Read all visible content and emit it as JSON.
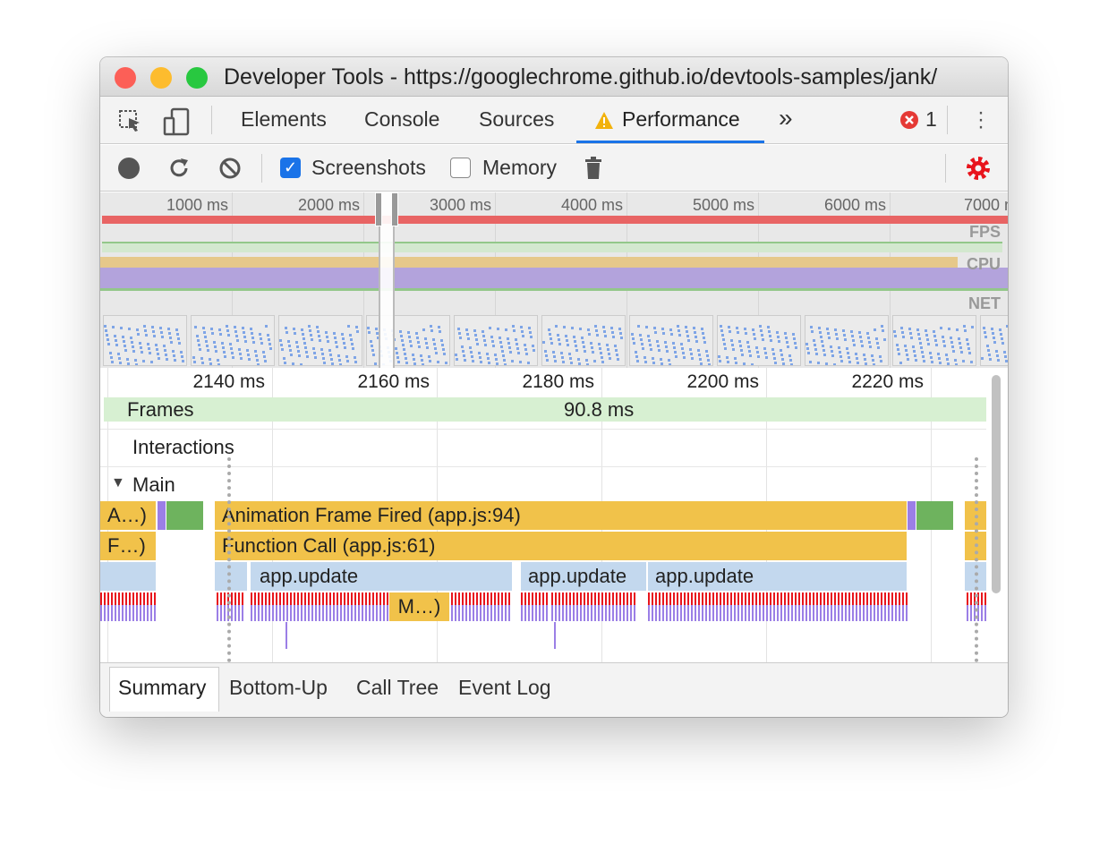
{
  "window": {
    "title": "Developer Tools - https://googlechrome.github.io/devtools-samples/jank/"
  },
  "tabs": {
    "items": [
      "Elements",
      "Console",
      "Sources",
      "Performance"
    ],
    "active": "Performance",
    "more": "»",
    "error_count": "1"
  },
  "toolbar": {
    "screenshots_label": "Screenshots",
    "screenshots_checked": true,
    "memory_label": "Memory",
    "memory_checked": false
  },
  "overview": {
    "ticks": [
      "1000 ms",
      "2000 ms",
      "3000 ms",
      "4000 ms",
      "5000 ms",
      "6000 ms",
      "7000 m"
    ],
    "labels": {
      "fps": "FPS",
      "cpu": "CPU",
      "net": "NET"
    }
  },
  "timeline": {
    "ticks": [
      "2140 ms",
      "2160 ms",
      "2180 ms",
      "2200 ms",
      "2220 ms"
    ],
    "frames_label": "Frames",
    "frame_duration": "90.8 ms",
    "interactions_label": "Interactions",
    "main_label": "Main"
  },
  "flame": {
    "animation_short": "A…)",
    "animation": "Animation Frame Fired (app.js:94)",
    "function_short": "F…)",
    "function": "Function Call (app.js:61)",
    "update": "app.update",
    "misc": "M…)"
  },
  "colors": {
    "scripting": "#f1c24a",
    "rendering": "#9b7fe6",
    "painting": "#6eb35e",
    "update": "#c3d8ee",
    "long_task": "#e86464"
  },
  "bottom_tabs": [
    "Summary",
    "Bottom-Up",
    "Call Tree",
    "Event Log"
  ]
}
